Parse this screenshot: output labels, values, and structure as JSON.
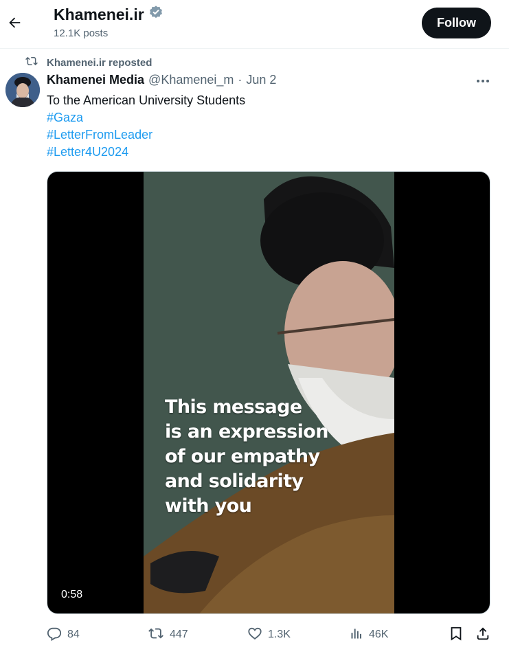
{
  "header": {
    "title": "Khamenei.ir",
    "posts_count": "12.1K posts",
    "follow_label": "Follow"
  },
  "repost": {
    "text": "Khamenei.ir reposted"
  },
  "tweet": {
    "name": "Khamenei Media",
    "handle": "@Khamenei_m",
    "separator": "·",
    "date": "Jun 2",
    "text_line": "To the American University Students",
    "hashtags": [
      "#Gaza",
      "#LetterFromLeader",
      "#Letter4U2024"
    ]
  },
  "media": {
    "caption_lines": [
      "This message",
      "is an expression",
      "of our empathy",
      "and solidarity",
      "with you"
    ],
    "duration": "0:58"
  },
  "actions": {
    "replies": "84",
    "reposts": "447",
    "likes": "1.3K",
    "views": "46K"
  },
  "colors": {
    "accent": "#1d9bf0",
    "text": "#0f1419",
    "muted": "#536471"
  },
  "icons": [
    "back-arrow-icon",
    "verified-badge-icon",
    "repost-icon",
    "more-icon",
    "reply-icon",
    "like-icon",
    "views-icon",
    "bookmark-icon",
    "share-icon"
  ]
}
